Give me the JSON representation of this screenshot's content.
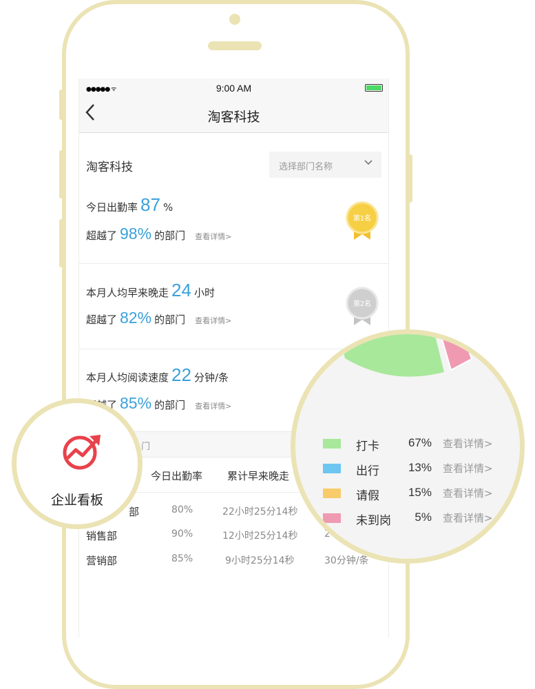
{
  "status_bar": {
    "signal": "●●●●● ᯤ",
    "time": "9:00 AM"
  },
  "nav": {
    "back_icon": "chevron-left-icon",
    "title": "淘客科技"
  },
  "company": {
    "name": "淘客科技",
    "select_placeholder": "选择部门名称"
  },
  "stats": [
    {
      "label": "今日出勤率",
      "value": "87",
      "unit": "%",
      "beat_prefix": "超越了",
      "beat_value": "98%",
      "beat_suffix": "的部门",
      "link": "查看详情>",
      "medal": "第1名"
    },
    {
      "label": "本月人均早来晚走",
      "value": "24",
      "unit": "小时",
      "beat_prefix": "超越了",
      "beat_value": "82%",
      "beat_suffix": "的部门",
      "link": "查看详情>",
      "medal": "第2名"
    },
    {
      "label": "本月人均阅读速度",
      "value": "22",
      "unit": "分钟/条",
      "beat_prefix": "超越了",
      "beat_value": "85%",
      "beat_suffix": "的部门",
      "link": "查看详情>"
    }
  ],
  "table": {
    "section_title": "门",
    "headers": [
      "今日出勤率",
      "累计早来晚走"
    ],
    "rows": [
      {
        "dept": "部",
        "rate": "80%",
        "time": "22小时25分14秒",
        "speed": ""
      },
      {
        "dept": "销售部",
        "rate": "90%",
        "time": "12小时25分14秒",
        "speed": "2"
      },
      {
        "dept": "营销部",
        "rate": "85%",
        "time": "9小时25分14秒",
        "speed": "30分钟/条"
      }
    ]
  },
  "board": {
    "label": "企业看板",
    "icon": "growth-chart-icon"
  },
  "legend": [
    {
      "name": "打卡",
      "pct": "67%",
      "link": "查看详情>",
      "color": "#a8e89a"
    },
    {
      "name": "出行",
      "pct": "13%",
      "link": "查看详情>",
      "color": "#6cc6ef"
    },
    {
      "name": "请假",
      "pct": "15%",
      "link": "查看详情>",
      "color": "#f9cc6b"
    },
    {
      "name": "未到岗",
      "pct": "5%",
      "link": "查看详情>",
      "color": "#f09ab2"
    }
  ],
  "colors": {
    "accent": "#3aa1db",
    "frame": "#ebe3b4",
    "gold": "#f7cf45",
    "silver": "#cfcfcf",
    "icon_red": "#e8424b"
  }
}
